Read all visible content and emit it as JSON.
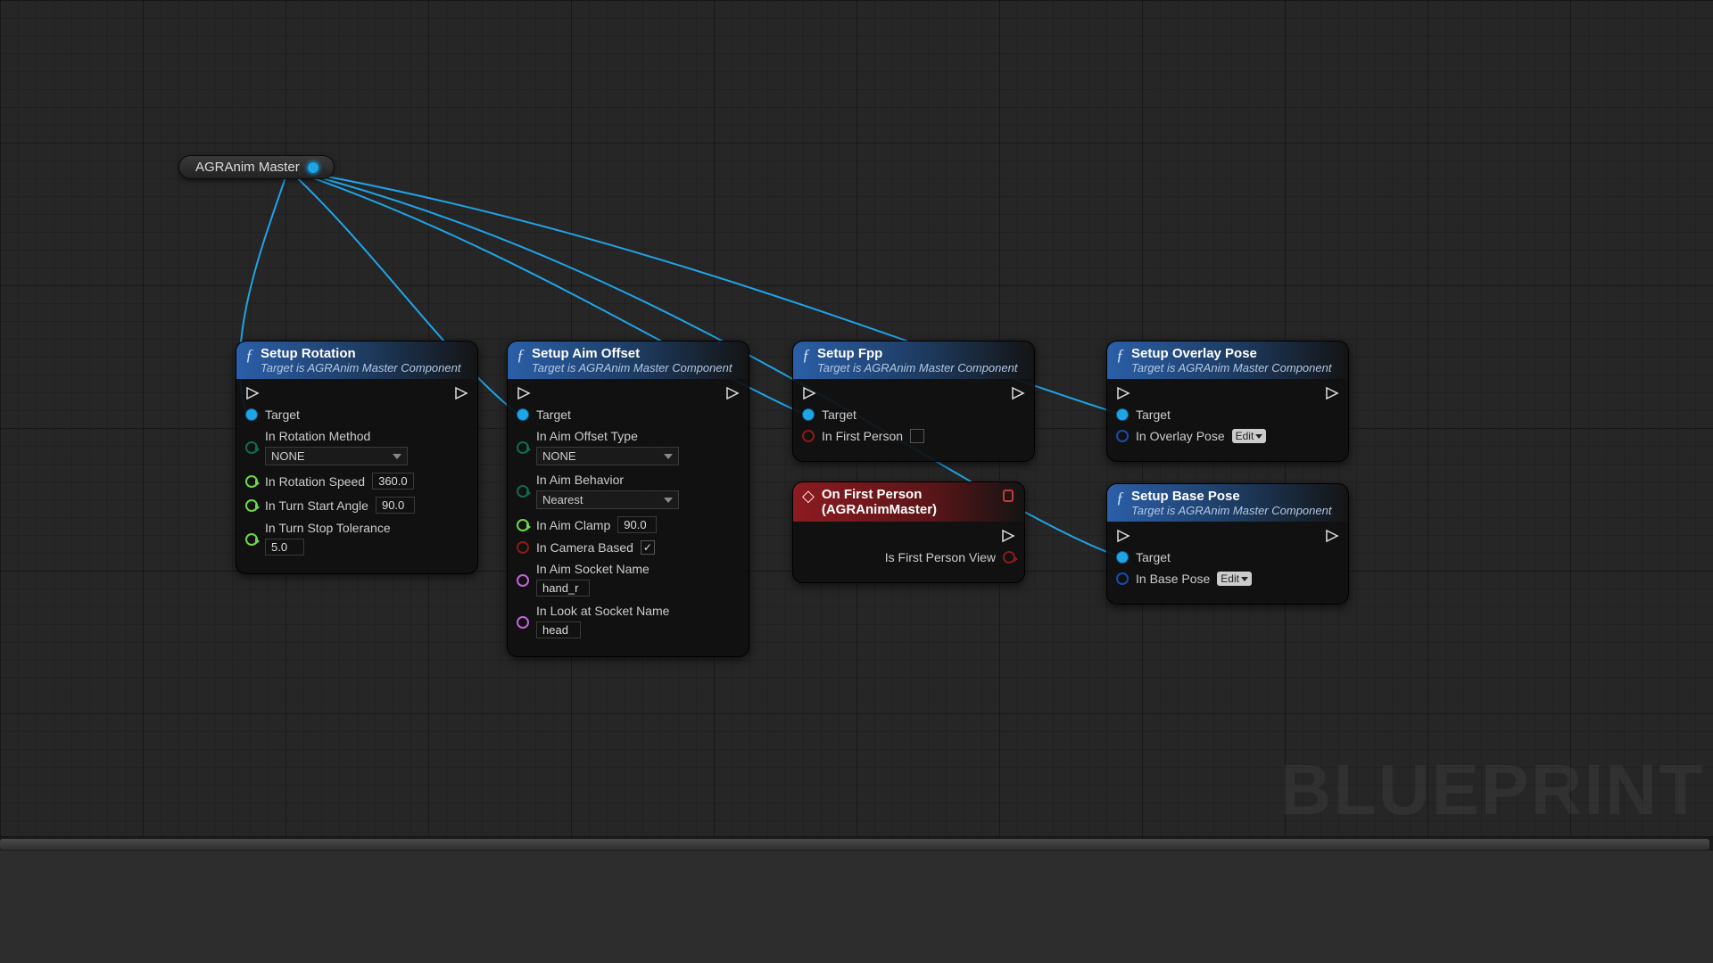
{
  "watermark": "BLUEPRINT",
  "variable_node": {
    "title": "AGRAnim Master"
  },
  "nodes": {
    "setup_rotation": {
      "title": "Setup Rotation",
      "subtitle": "Target is AGRAnim Master Component",
      "pins": {
        "target": "Target",
        "rotation_method": "In Rotation Method",
        "rotation_method_value": "NONE",
        "rotation_speed": "In Rotation Speed",
        "rotation_speed_value": "360.0",
        "turn_start_angle": "In Turn Start Angle",
        "turn_start_angle_value": "90.0",
        "turn_stop_tol": "In Turn Stop Tolerance",
        "turn_stop_tol_value": "5.0"
      }
    },
    "setup_aim_offset": {
      "title": "Setup Aim Offset",
      "subtitle": "Target is AGRAnim Master Component",
      "pins": {
        "target": "Target",
        "aim_offset_type": "In Aim Offset Type",
        "aim_offset_type_value": "NONE",
        "aim_behavior": "In Aim Behavior",
        "aim_behavior_value": "Nearest",
        "aim_clamp": "In Aim Clamp",
        "aim_clamp_value": "90.0",
        "camera_based": "In Camera Based",
        "camera_based_checked": "✓",
        "aim_socket": "In Aim Socket Name",
        "aim_socket_value": "hand_r",
        "look_at_socket": "In Look at Socket Name",
        "look_at_socket_value": "head"
      }
    },
    "setup_fpp": {
      "title": "Setup Fpp",
      "subtitle": "Target is AGRAnim Master Component",
      "pins": {
        "target": "Target",
        "in_first_person": "In First Person"
      }
    },
    "on_first_person": {
      "title": "On First Person (AGRAnimMaster)",
      "pins": {
        "is_first_person_view": "Is First Person View"
      }
    },
    "setup_overlay_pose": {
      "title": "Setup Overlay Pose",
      "subtitle": "Target is AGRAnim Master Component",
      "pins": {
        "target": "Target",
        "in_overlay_pose": "In Overlay Pose",
        "edit": "Edit"
      }
    },
    "setup_base_pose": {
      "title": "Setup Base Pose",
      "subtitle": "Target is AGRAnim Master Component",
      "pins": {
        "target": "Target",
        "in_base_pose": "In Base Pose",
        "edit": "Edit"
      }
    }
  }
}
